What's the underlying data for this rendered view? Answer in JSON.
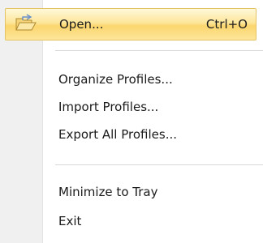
{
  "menu": {
    "items": [
      {
        "label": "Open...",
        "shortcut": "Ctrl+O",
        "icon": "open-folder-icon",
        "highlighted": true
      },
      {
        "label": "Organize Profiles..."
      },
      {
        "label": "Import Profiles..."
      },
      {
        "label": "Export All Profiles..."
      },
      {
        "label": "Minimize to Tray"
      },
      {
        "label": "Exit"
      }
    ]
  },
  "colors": {
    "highlight_border": "#e5c365",
    "highlight_fill": "#fde69a",
    "gutter": "#f0f0f0",
    "text": "#1b1b1b"
  }
}
